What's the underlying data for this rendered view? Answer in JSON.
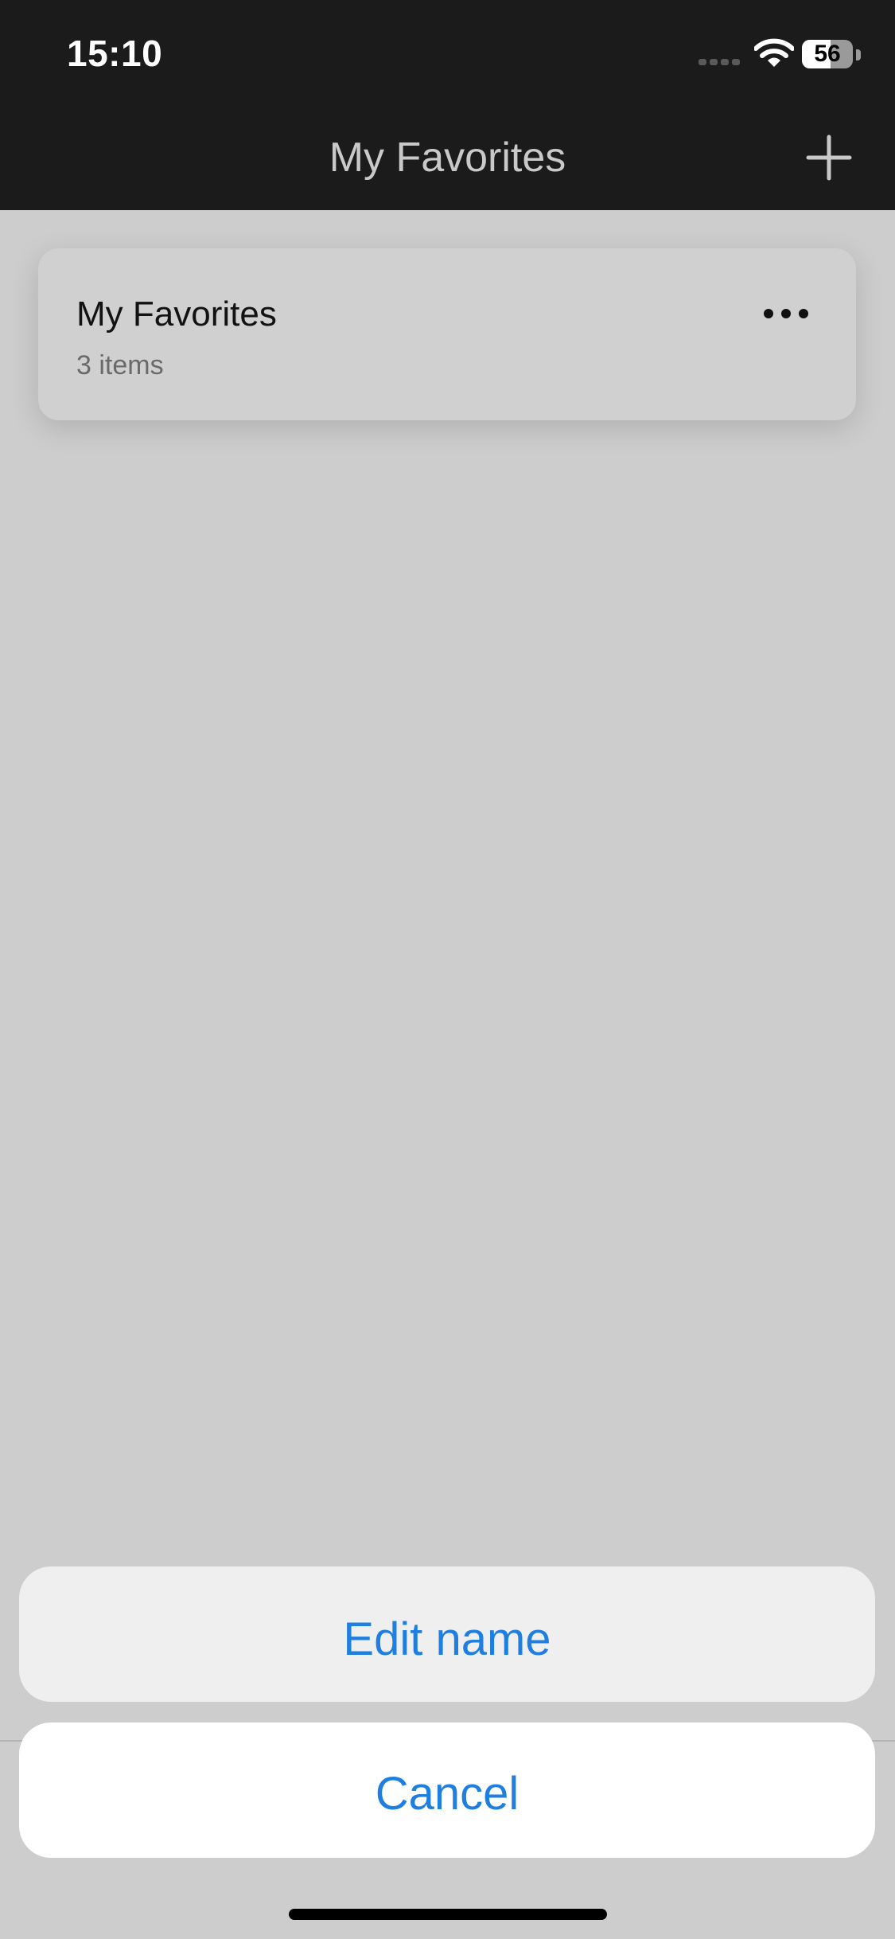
{
  "status_bar": {
    "time": "15:10",
    "battery_level": "56",
    "battery_fraction": 0.56
  },
  "nav": {
    "title": "My Favorites",
    "add_icon": "plus-icon"
  },
  "list": {
    "items": [
      {
        "title": "My Favorites",
        "count": "3 items",
        "menu_icon": "ellipsis-icon"
      }
    ]
  },
  "action_sheet": {
    "edit_label": "Edit name",
    "cancel_label": "Cancel"
  },
  "colors": {
    "accent": "#1f7fe0",
    "nav_background": "#1b1b1c",
    "dimmed_background": "#cdcdcd"
  }
}
